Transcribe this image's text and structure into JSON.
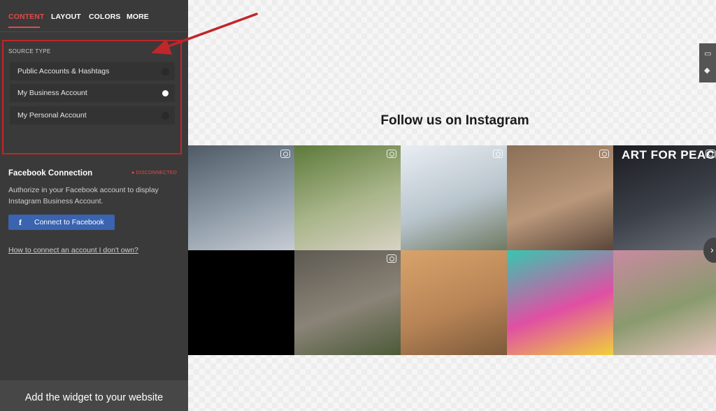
{
  "tabs": [
    "CONTENT",
    "LAYOUT",
    "COLORS",
    "MORE"
  ],
  "source_type": {
    "title": "SOURCE TYPE",
    "options": [
      {
        "label": "Public Accounts & Hashtags",
        "selected": false
      },
      {
        "label": "My Business Account",
        "selected": true
      },
      {
        "label": "My Personal Account",
        "selected": false
      }
    ]
  },
  "facebook": {
    "title": "Facebook Connection",
    "status": "DISCONNECTED",
    "description": "Authorize in your Facebook account to display Instagram Business Account.",
    "button_label": "Connect to Facebook",
    "help_link": "How to connect an account I don't own?"
  },
  "bottom_cta": {
    "label": "Add the widget to your website"
  },
  "preview": {
    "title": "Follow us on Instagram",
    "tiles": [
      {
        "name": "winter-forest-photo",
        "colors": [
          "#4f5a66",
          "#8d9aa6",
          "#c7ccd4"
        ]
      },
      {
        "name": "wooden-church-photo",
        "colors": [
          "#5d7a3a",
          "#a9b58a",
          "#d8d2c4"
        ]
      },
      {
        "name": "modern-building-photo",
        "colors": [
          "#e9eef3",
          "#b8c4cc",
          "#6f7a62"
        ]
      },
      {
        "name": "ancient-temple-photo",
        "colors": [
          "#8a6f57",
          "#b9977a",
          "#5a463a"
        ]
      },
      {
        "name": "art-for-peace-photo",
        "colors": [
          "#1b1d22",
          "#3c4048",
          "#6d717a"
        ],
        "caption": "ART FOR PEACE"
      },
      {
        "name": "empty-black-tile",
        "colors": [
          "#000000",
          "#000000",
          "#000000"
        ]
      },
      {
        "name": "chichen-itza-photo",
        "colors": [
          "#5e5a52",
          "#8a8377",
          "#4c5a38"
        ]
      },
      {
        "name": "pyramid-photo",
        "colors": [
          "#d8a36a",
          "#b88456",
          "#7c5a3a"
        ]
      },
      {
        "name": "holi-festival-photo",
        "colors": [
          "#37c7b0",
          "#e04fa4",
          "#f0d03a"
        ]
      },
      {
        "name": "taj-mahal-photo",
        "colors": [
          "#c98aa0",
          "#8a9a6e",
          "#e7c4bf"
        ]
      }
    ]
  }
}
